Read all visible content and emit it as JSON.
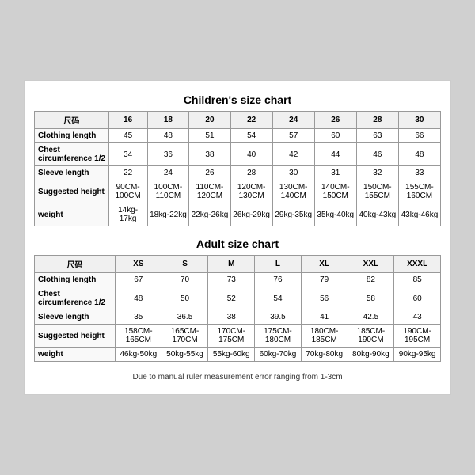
{
  "children_title": "Children's size chart",
  "adult_title": "Adult size chart",
  "note": "Due to manual ruler measurement error ranging from 1-3cm",
  "children_table": {
    "headers": [
      "尺码",
      "16",
      "18",
      "20",
      "22",
      "24",
      "26",
      "28",
      "30"
    ],
    "rows": [
      {
        "label": "Clothing length",
        "values": [
          "45",
          "48",
          "51",
          "54",
          "57",
          "60",
          "63",
          "66"
        ]
      },
      {
        "label": "Chest circumference 1/2",
        "values": [
          "34",
          "36",
          "38",
          "40",
          "42",
          "44",
          "46",
          "48"
        ]
      },
      {
        "label": "Sleeve length",
        "values": [
          "22",
          "24",
          "26",
          "28",
          "30",
          "31",
          "32",
          "33"
        ]
      },
      {
        "label": "Suggested height",
        "values": [
          "90CM-100CM",
          "100CM-110CM",
          "110CM-120CM",
          "120CM-130CM",
          "130CM-140CM",
          "140CM-150CM",
          "150CM-155CM",
          "155CM-160CM"
        ]
      },
      {
        "label": "weight",
        "values": [
          "14kg-17kg",
          "18kg-22kg",
          "22kg-26kg",
          "26kg-29kg",
          "29kg-35kg",
          "35kg-40kg",
          "40kg-43kg",
          "43kg-46kg"
        ]
      }
    ]
  },
  "adult_table": {
    "headers": [
      "尺码",
      "XS",
      "S",
      "M",
      "L",
      "XL",
      "XXL",
      "XXXL"
    ],
    "rows": [
      {
        "label": "Clothing length",
        "values": [
          "67",
          "70",
          "73",
          "76",
          "79",
          "82",
          "85"
        ]
      },
      {
        "label": "Chest circumference 1/2",
        "values": [
          "48",
          "50",
          "52",
          "54",
          "56",
          "58",
          "60"
        ]
      },
      {
        "label": "Sleeve length",
        "values": [
          "35",
          "36.5",
          "38",
          "39.5",
          "41",
          "42.5",
          "43"
        ]
      },
      {
        "label": "Suggested height",
        "values": [
          "158CM-165CM",
          "165CM-170CM",
          "170CM-175CM",
          "175CM-180CM",
          "180CM-185CM",
          "185CM-190CM",
          "190CM-195CM"
        ]
      },
      {
        "label": "weight",
        "values": [
          "46kg-50kg",
          "50kg-55kg",
          "55kg-60kg",
          "60kg-70kg",
          "70kg-80kg",
          "80kg-90kg",
          "90kg-95kg"
        ]
      }
    ]
  }
}
